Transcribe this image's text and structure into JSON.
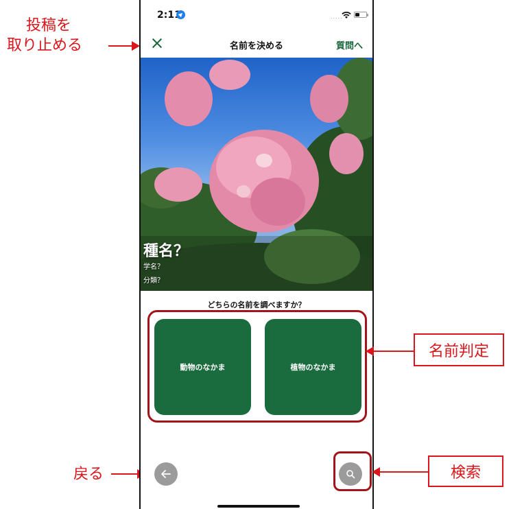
{
  "annotations": {
    "cancel_post": "投稿を\n取り止める",
    "cancel_post_line1": "投稿を",
    "cancel_post_line2": "取り止める",
    "name_judgment": "名前判定",
    "back": "戻る",
    "search": "検索"
  },
  "status_bar": {
    "time": "2:11",
    "signal": "....."
  },
  "nav": {
    "title": "名前を決める",
    "question_link": "質問へ"
  },
  "photo": {
    "species": "種名？",
    "scientific_name": "学名？",
    "classification": "分類？"
  },
  "prompt": "どちらの名前を調べますか？",
  "choices": [
    {
      "label": "動物のなかま"
    },
    {
      "label": "植物のなかま"
    }
  ],
  "icons": {
    "close": "close-icon",
    "back": "arrow-left-icon",
    "search": "search-icon",
    "location": "location-arrow-icon",
    "wifi": "wifi-icon",
    "battery": "battery-icon"
  },
  "colors": {
    "accent_green": "#1a6b3d",
    "annotation_red": "#d9161b",
    "button_gray": "#9b9b9b"
  }
}
